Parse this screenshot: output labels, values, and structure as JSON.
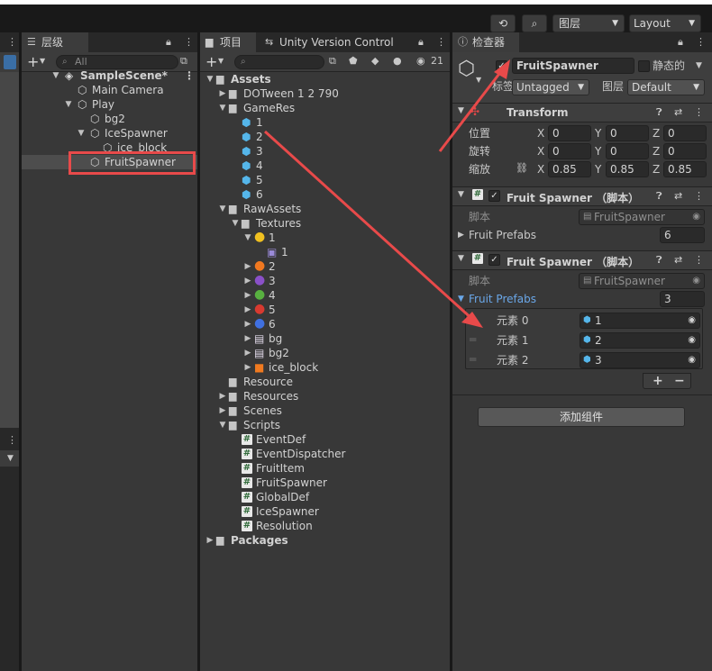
{
  "toolbar": {
    "history_icon": "history-icon",
    "search_icon": "search-icon",
    "layers_label": "图层",
    "layout_label": "Layout"
  },
  "hierarchy": {
    "tab_label": "层级",
    "search_placeholder": "All",
    "add_label": "+",
    "items": [
      {
        "label": "SampleScene*"
      },
      {
        "label": "Main Camera"
      },
      {
        "label": "Play"
      },
      {
        "label": "bg2"
      },
      {
        "label": "IceSpawner"
      },
      {
        "label": "ice_block"
      },
      {
        "label": "FruitSpawner"
      }
    ]
  },
  "project": {
    "tab_label": "项目",
    "tab2_label": "Unity Version Control",
    "eye_count": "21",
    "tree": [
      {
        "label": "Assets"
      },
      {
        "label": "DOTween 1 2 790"
      },
      {
        "label": "GameRes"
      },
      {
        "label": "1"
      },
      {
        "label": "2"
      },
      {
        "label": "3"
      },
      {
        "label": "4"
      },
      {
        "label": "5"
      },
      {
        "label": "6"
      },
      {
        "label": "RawAssets"
      },
      {
        "label": "Textures"
      },
      {
        "label": "1"
      },
      {
        "label": "1"
      },
      {
        "label": "2"
      },
      {
        "label": "3"
      },
      {
        "label": "4"
      },
      {
        "label": "5"
      },
      {
        "label": "6"
      },
      {
        "label": "bg"
      },
      {
        "label": "bg2"
      },
      {
        "label": "ice_block"
      },
      {
        "label": "Resource"
      },
      {
        "label": "Resources"
      },
      {
        "label": "Scenes"
      },
      {
        "label": "Scripts"
      },
      {
        "label": "EventDef"
      },
      {
        "label": "EventDispatcher"
      },
      {
        "label": "FruitItem"
      },
      {
        "label": "FruitSpawner"
      },
      {
        "label": "GlobalDef"
      },
      {
        "label": "IceSpawner"
      },
      {
        "label": "Resolution"
      },
      {
        "label": "Packages"
      }
    ]
  },
  "inspector": {
    "tab_label": "检查器",
    "object_name": "FruitSpawner",
    "static_label": "静态的",
    "tag_label": "标签",
    "tag_value": "Untagged",
    "layer_label": "图层",
    "layer_value": "Default",
    "transform": {
      "title": "Transform",
      "position_label": "位置",
      "rotation_label": "旋转",
      "scale_label": "缩放",
      "x": "X",
      "y": "Y",
      "z": "Z",
      "position": [
        "0",
        "0",
        "0"
      ],
      "rotation": [
        "0",
        "0",
        "0"
      ],
      "scale": [
        "0.85",
        "0.85",
        "0.85"
      ]
    },
    "comp1": {
      "title": "Fruit Spawner （脚本）",
      "script_label": "脚本",
      "script_value": "FruitSpawner",
      "prefabs_label": "Fruit Prefabs",
      "prefabs_count": "6"
    },
    "comp2": {
      "title": "Fruit Spawner （脚本）",
      "script_label": "脚本",
      "script_value": "FruitSpawner",
      "prefabs_label": "Fruit Prefabs",
      "prefabs_count": "3",
      "elements": [
        {
          "label": "元素 0",
          "value": "1"
        },
        {
          "label": "元素 1",
          "value": "2"
        },
        {
          "label": "元素 2",
          "value": "3"
        }
      ],
      "plus": "+",
      "minus": "−"
    },
    "add_component": "添加组件"
  },
  "colors": {
    "accent_red": "#e84a4a",
    "cube_blue": "#55b6ea",
    "link_blue": "#6aa7e8"
  }
}
